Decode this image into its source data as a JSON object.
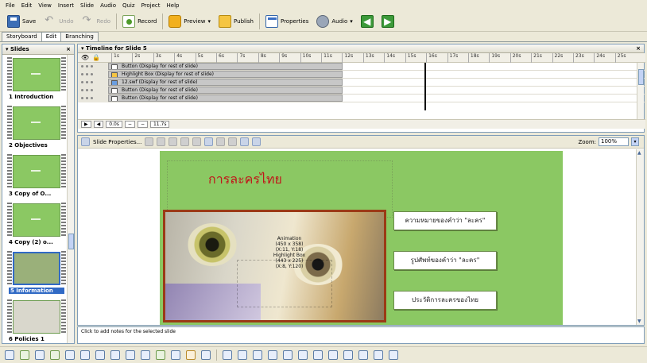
{
  "menu": [
    "File",
    "Edit",
    "View",
    "Insert",
    "Slide",
    "Audio",
    "Quiz",
    "Project",
    "Help"
  ],
  "toolbar": {
    "save": "Save",
    "undo": "Undo",
    "redo": "Redo",
    "record": "Record",
    "preview": "Preview",
    "publish": "Publish",
    "properties": "Properties",
    "audio": "Audio"
  },
  "tabs": [
    "Storyboard",
    "Edit",
    "Branching"
  ],
  "slides_panel": {
    "title": "Slides",
    "close": "×",
    "items": [
      {
        "label": "1 Introduction"
      },
      {
        "label": "2 Objectives"
      },
      {
        "label": "3 Copy of O..."
      },
      {
        "label": "4 Copy (2) o..."
      },
      {
        "label": "5 Information"
      },
      {
        "label": "6 Policies 1"
      }
    ]
  },
  "timeline": {
    "title": "Timeline for Slide 5",
    "close": "×",
    "ticks": [
      "1s",
      "2s",
      "3s",
      "4s",
      "5s",
      "6s",
      "7s",
      "8s",
      "9s",
      "10s",
      "11s",
      "12s",
      "13s",
      "14s",
      "15s",
      "16s",
      "17s",
      "18s",
      "19s",
      "20s",
      "21s",
      "22s",
      "23s",
      "24s",
      "25s"
    ],
    "rows": [
      "Button (Display for rest of slide)",
      "Highlight Box (Display for rest of slide)",
      "12.swf (Display for rest of slide)",
      "Button (Display for rest of slide)",
      "Button (Display for rest of slide)"
    ],
    "controls": [
      "0.0s",
      "11.7s"
    ]
  },
  "stage": {
    "slide_properties": "Slide Properties...",
    "zoom_label": "Zoom:",
    "zoom_value": "100%",
    "slide_title": "การละครไทย",
    "annotation": [
      "Animation",
      "(450 x 358)",
      "(X:11, Y:18)",
      "Highlight Box",
      "(443 x 225)",
      "(X:8, Y:120)"
    ],
    "buttons": [
      "ความหมายของคำว่า \"ละคร\"",
      "รูปศัพท์ของคำว่า \"ละคร\"",
      "ประวัติการละครของไทย"
    ]
  },
  "notes": "Click to add notes for the selected slide",
  "colors": {
    "slide_bg": "#8bc863",
    "title_red": "#c0161a",
    "selection_blue": "#316ac5"
  }
}
